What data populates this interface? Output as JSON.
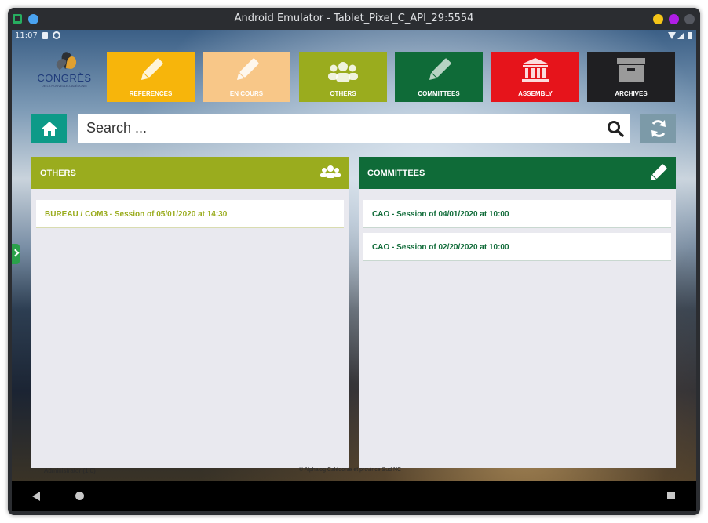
{
  "window": {
    "title": "Android Emulator - Tablet_Pixel_C_API_29:5554"
  },
  "statusbar": {
    "time": "11:07"
  },
  "logo": {
    "name": "CONGRÈS",
    "subtitle": "DE LA NOUVELLE-CALÉDONIE"
  },
  "tiles": [
    {
      "label": "REFERENCES",
      "color": "#f7b50b",
      "icon": "pencil-icon"
    },
    {
      "label": "EN COURS",
      "color": "#f8c788",
      "icon": "pencil-icon"
    },
    {
      "label": "OTHERS",
      "color": "#9aac1e",
      "icon": "users-icon"
    },
    {
      "label": "COMMITTEES",
      "color": "#0f6b38",
      "icon": "pencil-icon"
    },
    {
      "label": "ASSEMBLY",
      "color": "#e6141b",
      "icon": "bank-icon"
    },
    {
      "label": "ARCHIVES",
      "color": "#1f1f22",
      "icon": "archive-icon"
    }
  ],
  "search": {
    "placeholder": "Search ..."
  },
  "panels": {
    "others": {
      "title": "OTHERS",
      "items": [
        "BUREAU / COM3 - Session of 05/01/2020 at 14:30"
      ]
    },
    "committees": {
      "title": "COMMITTEES",
      "items": [
        "CAO - Session of 04/01/2020 at 10:00",
        "CAO - Session of 02/20/2020 at 10:00"
      ]
    }
  },
  "footer": {
    "user": "Administrator (1.0)",
    "copyright": "© Alphalog Calédonie et province Sud NC"
  }
}
